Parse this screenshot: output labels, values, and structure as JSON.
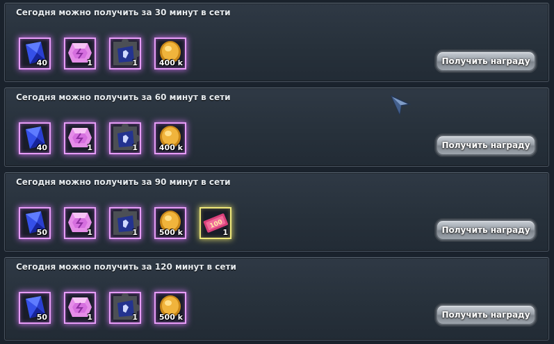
{
  "rewards": [
    {
      "title": "Сегодня можно получить за 30 минут в сети",
      "button": "Получить награду",
      "items": [
        {
          "icon": "blue-crystal-icon",
          "count": "40"
        },
        {
          "icon": "pink-gem-icon",
          "count": "1"
        },
        {
          "icon": "puzzle-ticket-icon",
          "count": "1"
        },
        {
          "icon": "gold-coin-icon",
          "count": "400 k"
        }
      ]
    },
    {
      "title": "Сегодня можно получить за 60 минут в сети",
      "button": "Получить награду",
      "items": [
        {
          "icon": "blue-crystal-icon",
          "count": "40"
        },
        {
          "icon": "pink-gem-icon",
          "count": "1"
        },
        {
          "icon": "puzzle-ticket-icon",
          "count": "1"
        },
        {
          "icon": "gold-coin-icon",
          "count": "400 k"
        }
      ]
    },
    {
      "title": "Сегодня можно получить за 90 минут в сети",
      "button": "Получить награду",
      "items": [
        {
          "icon": "blue-crystal-icon",
          "count": "50"
        },
        {
          "icon": "pink-gem-icon",
          "count": "1"
        },
        {
          "icon": "puzzle-ticket-icon",
          "count": "1"
        },
        {
          "icon": "gold-coin-icon",
          "count": "500 k"
        },
        {
          "icon": "voucher-100-icon",
          "count": "1",
          "label": "100"
        }
      ]
    },
    {
      "title": "Сегодня можно получить за 120 минут в сети",
      "button": "Получить награду",
      "items": [
        {
          "icon": "blue-crystal-icon",
          "count": "50"
        },
        {
          "icon": "pink-gem-icon",
          "count": "1"
        },
        {
          "icon": "puzzle-ticket-icon",
          "count": "1"
        },
        {
          "icon": "gold-coin-icon",
          "count": "500 k"
        }
      ]
    }
  ],
  "colors": {
    "purple_frame": "#e79cf7",
    "gold_frame": "#eee77a",
    "panel_bg": "#2b3540"
  }
}
